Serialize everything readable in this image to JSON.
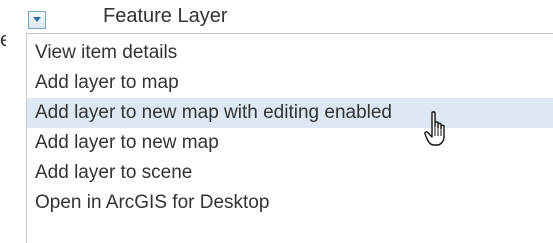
{
  "header": {
    "partial_label": "e",
    "title": "Feature Layer"
  },
  "menu": {
    "items": [
      {
        "label": "View item details"
      },
      {
        "label": "Add layer to map"
      },
      {
        "label": "Add layer to new map with editing enabled",
        "highlighted": true
      },
      {
        "label": "Add layer to new map"
      },
      {
        "label": "Add layer to scene"
      },
      {
        "label": "Open in ArcGIS for Desktop"
      }
    ]
  },
  "icons": {
    "toggle": "chevron-down-icon",
    "cursor": "hand-pointer-cursor-icon"
  },
  "colors": {
    "highlight": "#dde8f3",
    "text": "#333333",
    "toggle_border": "#7aa7c7",
    "menu_border": "#c8c8c8"
  }
}
